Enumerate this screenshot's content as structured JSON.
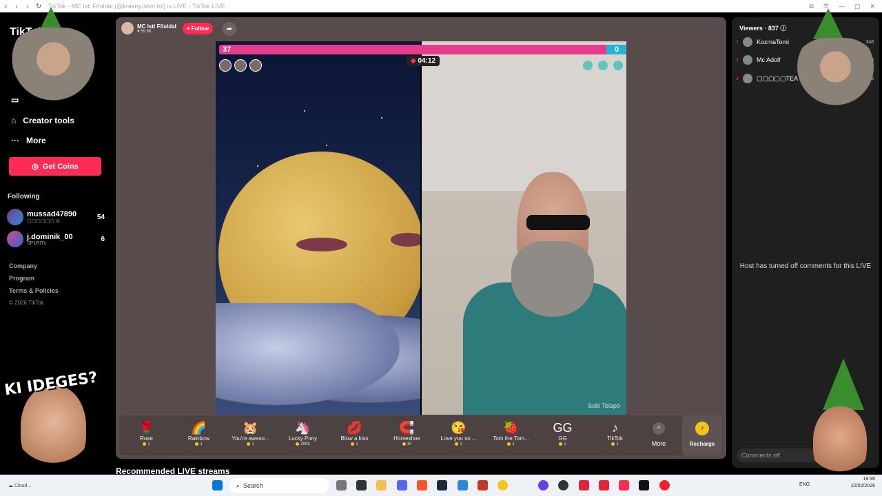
{
  "browser": {
    "title": "TikTok - MC Isti Fõoldal (@krakny.istvn.fol) is LIVE - TikTok LIVE"
  },
  "sidebar": {
    "logo": "TikTok",
    "creator_tools": "Creator tools",
    "more": "More",
    "get_coins": "Get Coins",
    "following_title": "Following",
    "following": [
      {
        "name": "mussad47890",
        "sub": "▢▢▢▢▢▢ ◎",
        "count": "54"
      },
      {
        "name": "j.dominik_00",
        "sub": "SP1RITx",
        "count": "6"
      }
    ],
    "footer": [
      "Company",
      "Program",
      "Terms & Policies"
    ],
    "copyright": "© 2026 TikTok"
  },
  "overlay": {
    "ki_ideges": "KI IDEGES?"
  },
  "live": {
    "host_name": "MC Isti Fõoldal",
    "host_likes": "59.9K",
    "follow_label": "+ Follow",
    "score_left": "37",
    "score_right": "0",
    "timer": "04:12",
    "watermark": "Sobi Telapó"
  },
  "gifts": [
    {
      "icon": "🌹",
      "name": "Rose",
      "price": "1"
    },
    {
      "icon": "🌈",
      "name": "Rainbow",
      "price": "1"
    },
    {
      "icon": "🐹",
      "name": "You're aweso...",
      "price": "1"
    },
    {
      "icon": "🦄",
      "name": "Lucky Pony",
      "price": "2999"
    },
    {
      "icon": "💋",
      "name": "Blow a kiss",
      "price": "1"
    },
    {
      "icon": "🧲",
      "name": "Horseshoe",
      "price": "10"
    },
    {
      "icon": "😘",
      "name": "Love you so ...",
      "price": "1"
    },
    {
      "icon": "🍓",
      "name": "Tom the Tom...",
      "price": "1"
    },
    {
      "icon": "GG",
      "name": "GG",
      "price": "1"
    },
    {
      "icon": "♪",
      "name": "TikTok",
      "price": "1"
    }
  ],
  "gift_more": "More",
  "recharge": "Recharge",
  "recommended": "Recommended LIVE streams",
  "viewers": {
    "title": "Viewers · 837",
    "list": [
      {
        "rank": "1",
        "name": "KozmaTomi",
        "score": "348"
      },
      {
        "rank": "2",
        "name": "Mc Adolf",
        "score": "345"
      },
      {
        "rank": "3",
        "name": "▢▢▢▢▢TEA",
        "score": "298"
      }
    ]
  },
  "comments_off_msg": "Host has turned off comments for this LIVE",
  "comments_placeholder": "Comments off",
  "taskbar": {
    "weather": "Cloud...",
    "search": "Search",
    "lang": "ENG",
    "time": "19:36",
    "date": "22/02/2026"
  },
  "colors": {
    "accent": "#fe2c55",
    "panel": "#574b4b",
    "score_blue": "#23b5d3"
  }
}
